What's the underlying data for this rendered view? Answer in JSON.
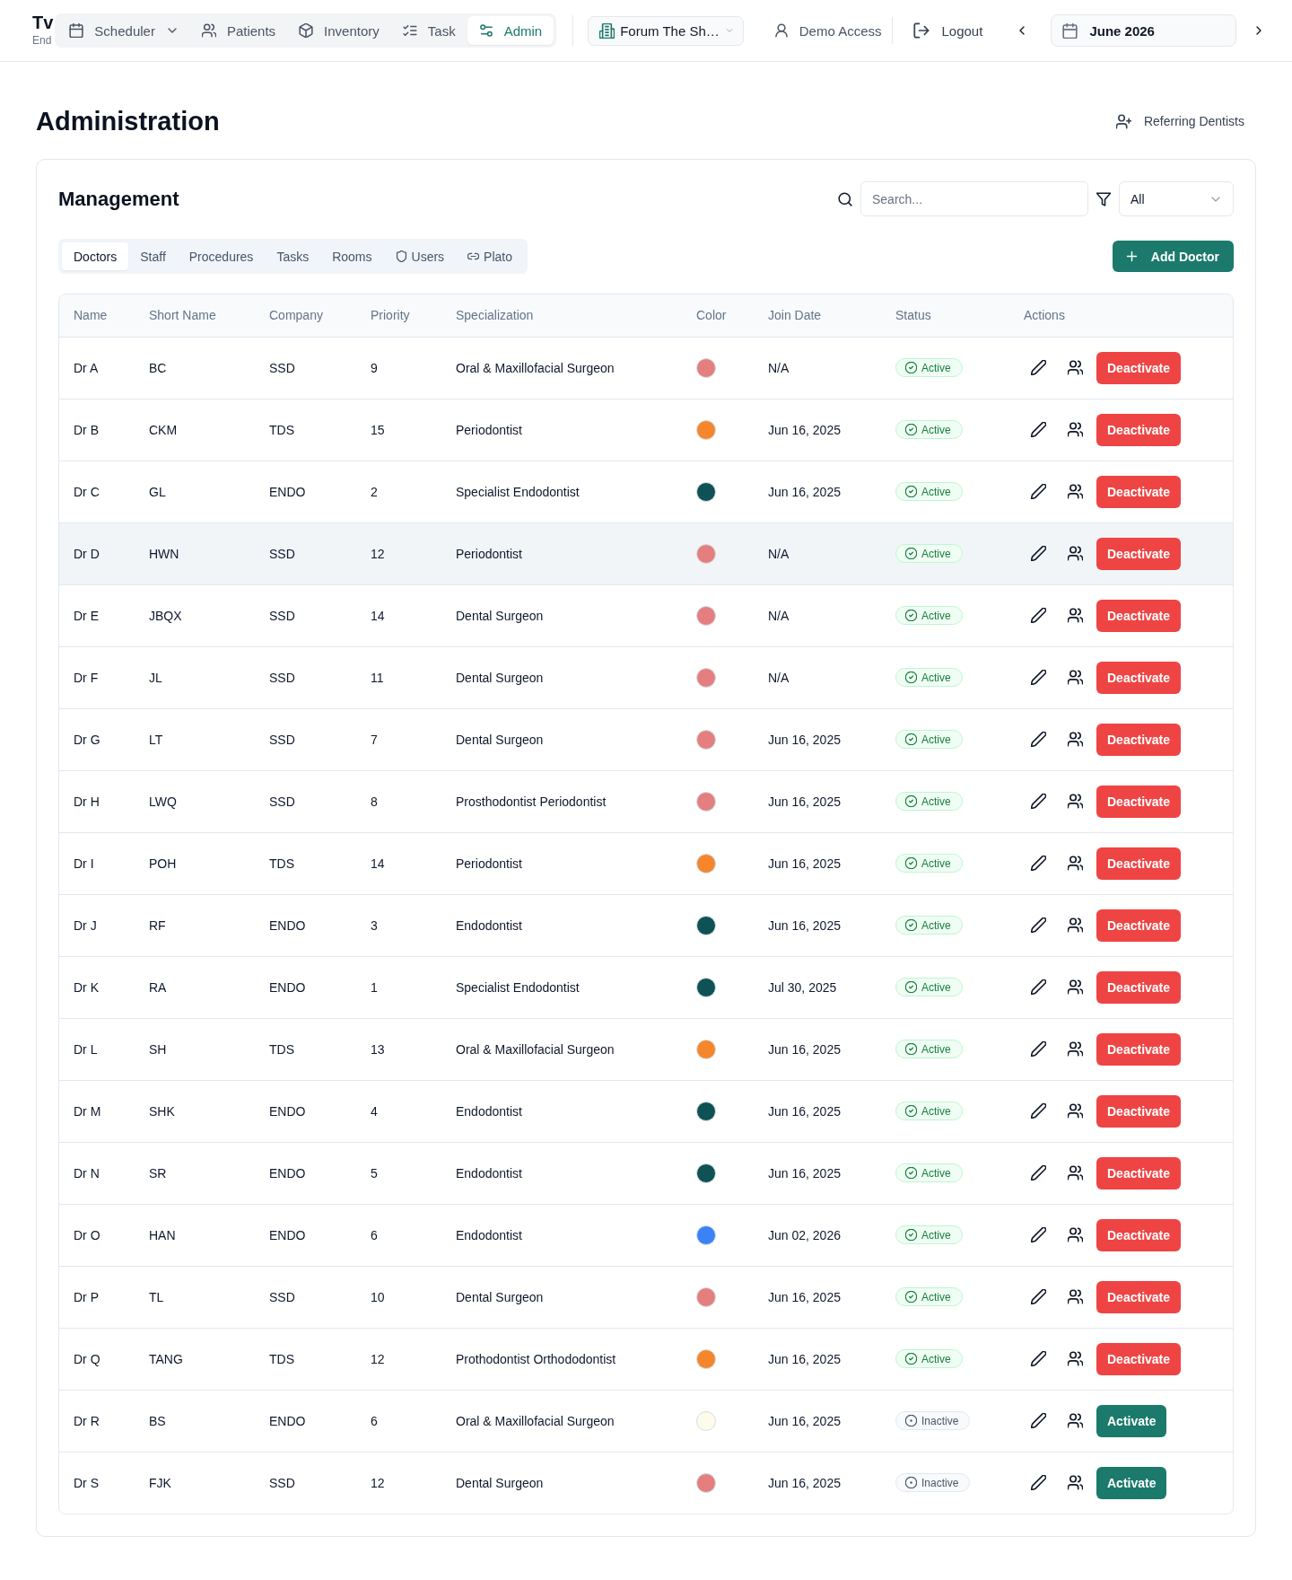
{
  "header": {
    "brand": {
      "title": "Tv",
      "subtitle": "End"
    },
    "nav": [
      {
        "label": "Scheduler",
        "selected": false,
        "dropdown": true
      },
      {
        "label": "Patients",
        "selected": false,
        "dropdown": false
      },
      {
        "label": "Inventory",
        "selected": false,
        "dropdown": false
      },
      {
        "label": "Task",
        "selected": false,
        "dropdown": false
      },
      {
        "label": "Admin",
        "selected": true,
        "dropdown": false
      }
    ],
    "location": {
      "label": "Forum The Sh…"
    },
    "user": {
      "label": "Demo Access"
    },
    "logout": {
      "label": "Logout"
    },
    "month": {
      "label": "June 2026"
    }
  },
  "page": {
    "title": "Administration",
    "action": {
      "label": "Referring Dentists"
    }
  },
  "management": {
    "title": "Management",
    "search": {
      "placeholder": "Search..."
    },
    "filter": {
      "value": "All"
    },
    "tabs": [
      {
        "label": "Doctors",
        "selected": true
      },
      {
        "label": "Staff",
        "selected": false
      },
      {
        "label": "Procedures",
        "selected": false
      },
      {
        "label": "Tasks",
        "selected": false
      },
      {
        "label": "Rooms",
        "selected": false
      },
      {
        "label": "Users",
        "selected": false
      },
      {
        "label": "Plato",
        "selected": false
      }
    ],
    "add_button": {
      "label": "Add Doctor"
    },
    "table": {
      "columns": [
        "Name",
        "Short Name",
        "Company",
        "Priority",
        "Specialization",
        "Color",
        "Join Date",
        "Status",
        "Actions"
      ],
      "rows": [
        {
          "name": "Dr A",
          "short_name": "BC",
          "company": "SSD",
          "priority": "9",
          "specialization": "Oral & Maxillofacial Surgeon",
          "color": "#e57f7f",
          "join_date": "N/A",
          "status": "Active",
          "active": true,
          "action": "Deactivate",
          "highlighted": false
        },
        {
          "name": "Dr B",
          "short_name": "CKM",
          "company": "TDS",
          "priority": "15",
          "specialization": "Periodontist",
          "color": "#f5862b",
          "join_date": "Jun 16, 2025",
          "status": "Active",
          "active": true,
          "action": "Deactivate",
          "highlighted": false
        },
        {
          "name": "Dr C",
          "short_name": "GL",
          "company": "ENDO",
          "priority": "2",
          "specialization": "Specialist Endodontist",
          "color": "#0f5255",
          "join_date": "Jun 16, 2025",
          "status": "Active",
          "active": true,
          "action": "Deactivate",
          "highlighted": false
        },
        {
          "name": "Dr D",
          "short_name": "HWN",
          "company": "SSD",
          "priority": "12",
          "specialization": "Periodontist",
          "color": "#e57f7f",
          "join_date": "N/A",
          "status": "Active",
          "active": true,
          "action": "Deactivate",
          "highlighted": true
        },
        {
          "name": "Dr E",
          "short_name": "JBQX",
          "company": "SSD",
          "priority": "14",
          "specialization": "Dental Surgeon",
          "color": "#e57f7f",
          "join_date": "N/A",
          "status": "Active",
          "active": true,
          "action": "Deactivate",
          "highlighted": false
        },
        {
          "name": "Dr F",
          "short_name": "JL",
          "company": "SSD",
          "priority": "11",
          "specialization": "Dental Surgeon",
          "color": "#e57f7f",
          "join_date": "N/A",
          "status": "Active",
          "active": true,
          "action": "Deactivate",
          "highlighted": false
        },
        {
          "name": "Dr G",
          "short_name": "LT",
          "company": "SSD",
          "priority": "7",
          "specialization": "Dental Surgeon",
          "color": "#e57f7f",
          "join_date": "Jun 16, 2025",
          "status": "Active",
          "active": true,
          "action": "Deactivate",
          "highlighted": false
        },
        {
          "name": "Dr H",
          "short_name": "LWQ",
          "company": "SSD",
          "priority": "8",
          "specialization": "Prosthodontist Periodontist",
          "color": "#e57f7f",
          "join_date": "Jun 16, 2025",
          "status": "Active",
          "active": true,
          "action": "Deactivate",
          "highlighted": false
        },
        {
          "name": "Dr I",
          "short_name": "POH",
          "company": "TDS",
          "priority": "14",
          "specialization": "Periodontist",
          "color": "#f5862b",
          "join_date": "Jun 16, 2025",
          "status": "Active",
          "active": true,
          "action": "Deactivate",
          "highlighted": false
        },
        {
          "name": "Dr J",
          "short_name": "RF",
          "company": "ENDO",
          "priority": "3",
          "specialization": "Endodontist",
          "color": "#0f5255",
          "join_date": "Jun 16, 2025",
          "status": "Active",
          "active": true,
          "action": "Deactivate",
          "highlighted": false
        },
        {
          "name": "Dr K",
          "short_name": "RA",
          "company": "ENDO",
          "priority": "1",
          "specialization": "Specialist Endodontist",
          "color": "#0f5255",
          "join_date": "Jul 30, 2025",
          "status": "Active",
          "active": true,
          "action": "Deactivate",
          "highlighted": false
        },
        {
          "name": "Dr L",
          "short_name": "SH",
          "company": "TDS",
          "priority": "13",
          "specialization": "Oral & Maxillofacial Surgeon",
          "color": "#f5862b",
          "join_date": "Jun 16, 2025",
          "status": "Active",
          "active": true,
          "action": "Deactivate",
          "highlighted": false
        },
        {
          "name": "Dr M",
          "short_name": "SHK",
          "company": "ENDO",
          "priority": "4",
          "specialization": "Endodontist",
          "color": "#0f5255",
          "join_date": "Jun 16, 2025",
          "status": "Active",
          "active": true,
          "action": "Deactivate",
          "highlighted": false
        },
        {
          "name": "Dr N",
          "short_name": "SR",
          "company": "ENDO",
          "priority": "5",
          "specialization": "Endodontist",
          "color": "#0f5255",
          "join_date": "Jun 16, 2025",
          "status": "Active",
          "active": true,
          "action": "Deactivate",
          "highlighted": false
        },
        {
          "name": "Dr O",
          "short_name": "HAN",
          "company": "ENDO",
          "priority": "6",
          "specialization": "Endodontist",
          "color": "#3b82f6",
          "join_date": "Jun 02, 2026",
          "status": "Active",
          "active": true,
          "action": "Deactivate",
          "highlighted": false
        },
        {
          "name": "Dr P",
          "short_name": "TL",
          "company": "SSD",
          "priority": "10",
          "specialization": "Dental Surgeon",
          "color": "#e57f7f",
          "join_date": "Jun 16, 2025",
          "status": "Active",
          "active": true,
          "action": "Deactivate",
          "highlighted": false
        },
        {
          "name": "Dr Q",
          "short_name": "TANG",
          "company": "TDS",
          "priority": "12",
          "specialization": "Prothodontist Orthododontist",
          "color": "#f5862b",
          "join_date": "Jun 16, 2025",
          "status": "Active",
          "active": true,
          "action": "Deactivate",
          "highlighted": false
        },
        {
          "name": "Dr R",
          "short_name": "BS",
          "company": "ENDO",
          "priority": "6",
          "specialization": "Oral & Maxillofacial Surgeon",
          "color": "#fdfbea",
          "join_date": "Jun 16, 2025",
          "status": "Inactive",
          "active": false,
          "action": "Activate",
          "highlighted": false
        },
        {
          "name": "Dr S",
          "short_name": "FJK",
          "company": "SSD",
          "priority": "12",
          "specialization": "Dental Surgeon",
          "color": "#e57f7f",
          "join_date": "Jun 16, 2025",
          "status": "Inactive",
          "active": false,
          "action": "Activate",
          "highlighted": false
        }
      ]
    }
  }
}
